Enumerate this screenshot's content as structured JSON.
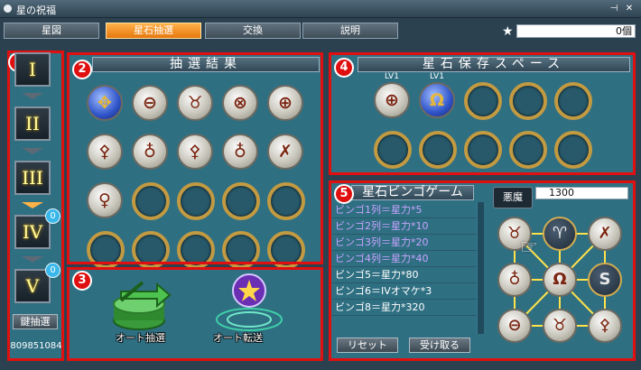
{
  "window": {
    "title": "星の祝福",
    "pin_icon": "pin-icon",
    "close_icon": "close-icon"
  },
  "tabs": [
    {
      "label": "星図",
      "active": false
    },
    {
      "label": "星石抽選",
      "active": true
    },
    {
      "label": "交換",
      "active": false
    },
    {
      "label": "説明",
      "active": false
    }
  ],
  "star_count": "0個",
  "annotations": [
    "1",
    "2",
    "3",
    "4",
    "5"
  ],
  "sidebar": {
    "ranks": [
      "I",
      "II",
      "III",
      "IV",
      "V"
    ],
    "iv_badge": "0",
    "v_badge": "0",
    "key_button": "鍵抽選",
    "key_count": "809851084"
  },
  "results": {
    "header": "抽選結果",
    "stones": [
      {
        "glyph": "✥",
        "style": "blue"
      },
      {
        "glyph": "⊖",
        "style": "light"
      },
      {
        "glyph": "♉",
        "style": "light"
      },
      {
        "glyph": "⊗",
        "style": "light"
      },
      {
        "glyph": "⊕",
        "style": "light"
      },
      {
        "glyph": "⚴",
        "style": "light"
      },
      {
        "glyph": "♁",
        "style": "light"
      },
      {
        "glyph": "⚴",
        "style": "light"
      },
      {
        "glyph": "♁",
        "style": "light"
      },
      {
        "glyph": "✗",
        "style": "light"
      },
      {
        "glyph": "♀",
        "style": "light"
      }
    ],
    "total_slots": 20
  },
  "auto": {
    "draw_label": "オート抽選",
    "transfer_label": "オート転送"
  },
  "storage": {
    "header": "星石保存スペース",
    "stones": [
      {
        "glyph": "⊕",
        "style": "light",
        "level": "LV1"
      },
      {
        "glyph": "Ω",
        "style": "blue",
        "level": "LV1"
      }
    ],
    "total_slots": 10
  },
  "bingo": {
    "header": "星石ビンゴゲーム",
    "lines": [
      {
        "text": "ビンゴ1列＝星力*5",
        "active": true
      },
      {
        "text": "ビンゴ2列＝星力*10",
        "active": true
      },
      {
        "text": "ビンゴ3列＝星力*20",
        "active": true
      },
      {
        "text": "ビンゴ4列＝星力*40",
        "active": true
      },
      {
        "text": "ビンゴ5＝星力*80",
        "active": false
      },
      {
        "text": "ビンゴ6＝IVオマケ*3",
        "active": false
      },
      {
        "text": "ビンゴ8＝星力*320",
        "active": false
      }
    ],
    "reset_button": "リセット",
    "receive_button": "受け取る",
    "tooltip": "悪魔",
    "value": "1300",
    "grid": [
      {
        "glyph": "♉",
        "style": "light"
      },
      {
        "glyph": "♈",
        "style": "dark"
      },
      {
        "glyph": "✗",
        "style": "light"
      },
      {
        "glyph": "♁",
        "style": "light"
      },
      {
        "glyph": "Ω",
        "style": "light"
      },
      {
        "glyph": "S",
        "style": "dark"
      },
      {
        "glyph": "⊖",
        "style": "light"
      },
      {
        "glyph": "♉",
        "style": "light"
      },
      {
        "glyph": "⚴",
        "style": "light"
      }
    ]
  }
}
